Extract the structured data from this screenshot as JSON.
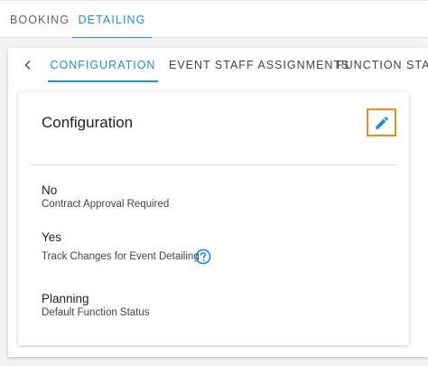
{
  "top_tabs": [
    {
      "label": "BOOKING"
    },
    {
      "label": "DETAILING"
    }
  ],
  "sub_tabs": [
    {
      "label": "CONFIGURATION"
    },
    {
      "label": "EVENT STAFF ASSIGNMENTS"
    },
    {
      "label": "FUNCTION STAFF"
    }
  ],
  "card": {
    "title": "Configuration",
    "fields": [
      {
        "value": "No",
        "label": "Contract Approval Required"
      },
      {
        "value": "Yes",
        "label": "Track Changes for Event Detailing"
      },
      {
        "value": "Planning",
        "label": "Default Function Status"
      }
    ]
  },
  "colors": {
    "accent": "#1f8fd6",
    "highlight": "#f08a24",
    "background": "#f2f2f2"
  },
  "icons": {
    "back": "chevron-left-icon",
    "edit": "pencil-icon",
    "help": "help-circle-icon"
  }
}
